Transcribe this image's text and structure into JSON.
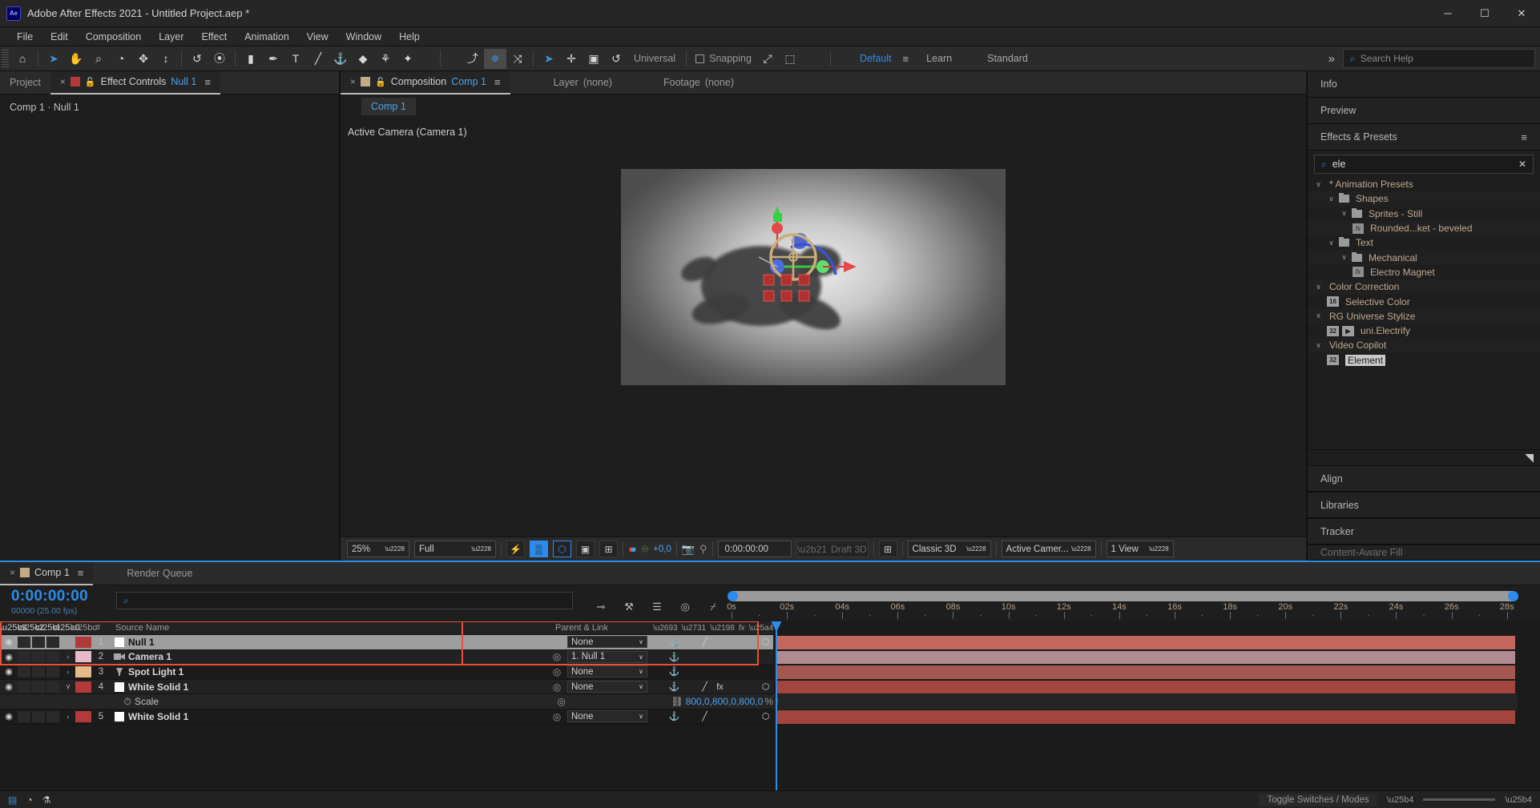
{
  "window": {
    "title": "Adobe After Effects 2021 - Untitled Project.aep *",
    "logo": "Ae",
    "minimize": "─",
    "maximize": "☐",
    "close": "✕"
  },
  "menubar": [
    "File",
    "Edit",
    "Composition",
    "Layer",
    "Effect",
    "Animation",
    "View",
    "Window",
    "Help"
  ],
  "toolbar": {
    "tools": [
      {
        "name": "home-icon",
        "glyph": "⌂"
      },
      {
        "name": "selection-tool",
        "glyph": "➤"
      },
      {
        "name": "hand-tool",
        "glyph": "✋"
      },
      {
        "name": "zoom-tool",
        "glyph": "⌕"
      },
      {
        "name": "orbit-tool",
        "glyph": "◔"
      },
      {
        "name": "pan-tool",
        "glyph": "✥"
      },
      {
        "name": "dolly-tool",
        "glyph": "↕"
      },
      {
        "name": "rotation-tool",
        "glyph": "↺"
      },
      {
        "name": "anchor-point-tool",
        "glyph": "⦿"
      },
      {
        "name": "rect-shape-tool",
        "glyph": "▮"
      },
      {
        "name": "pen-tool",
        "glyph": "✒"
      },
      {
        "name": "type-tool",
        "glyph": "T"
      },
      {
        "name": "brush-tool",
        "glyph": "╱"
      },
      {
        "name": "clone-stamp-tool",
        "glyph": "⚓"
      },
      {
        "name": "eraser-tool",
        "glyph": "◆"
      },
      {
        "name": "roto-brush-tool",
        "glyph": "⚘"
      },
      {
        "name": "puppet-pin-tool",
        "glyph": "✦"
      }
    ],
    "axis_tools": [
      {
        "name": "local-axis-mode",
        "glyph": "⤴"
      },
      {
        "name": "world-axis-mode",
        "glyph": "✵"
      },
      {
        "name": "view-axis-mode",
        "glyph": "⤨"
      }
    ],
    "gizmo_tools": [
      {
        "name": "gizmo-select",
        "glyph": "➤"
      },
      {
        "name": "gizmo-position",
        "glyph": "✛"
      },
      {
        "name": "gizmo-scale",
        "glyph": "▣"
      },
      {
        "name": "gizmo-rotate",
        "glyph": "↺"
      }
    ],
    "universal_label": "Universal",
    "snapping_label": "Snapping",
    "snap_tools": [
      {
        "name": "snap-align-icon",
        "glyph": "⤢"
      },
      {
        "name": "snap-grid-icon",
        "glyph": "⬚"
      }
    ],
    "workspaces": [
      "Default",
      "Learn",
      "Standard"
    ],
    "active_workspace": "Default",
    "workspace_menu_icon": "≡",
    "overflow_icon": "»",
    "search_help_placeholder": "Search Help",
    "search_icon": "⌕"
  },
  "left_panel": {
    "tabs": [
      {
        "label": "Project",
        "active": false,
        "name": "tab-project"
      },
      {
        "label": "Effect Controls",
        "sub": "Null 1",
        "active": true,
        "name": "tab-effect-controls",
        "swatch": "#b33a3a",
        "close": "×",
        "lock": "🔓",
        "menu": "≡"
      }
    ],
    "breadcrumb": "Comp 1 · Null 1"
  },
  "composition_panel": {
    "tabs": [
      {
        "label": "Composition",
        "sub": "Comp 1",
        "active": true,
        "name": "tab-composition",
        "swatch": "#c4ab83",
        "close": "×",
        "lock": "🔓",
        "menu": "≡"
      },
      {
        "label": "Layer",
        "sub": "(none)",
        "active": false,
        "name": "tab-layer"
      },
      {
        "label": "Footage",
        "sub": "(none)",
        "active": false,
        "name": "tab-footage"
      }
    ],
    "sub_tab": "Comp 1",
    "view_label": "Active Camera (Camera 1)",
    "viewer_bar": {
      "zoom": "25%",
      "resolution": "Full",
      "timecode": "0:00:00:00",
      "exposure": "+0,0",
      "draft3d": "Draft 3D",
      "renderer": "Classic 3D",
      "camera": "Active Camer...",
      "views": "1 View",
      "toggles": [
        {
          "name": "fast-preview-icon",
          "glyph": "⚡",
          "on": false
        },
        {
          "name": "transparency-grid-icon",
          "glyph": "▒",
          "on": true
        },
        {
          "name": "region-of-interest-icon",
          "glyph": "⬡",
          "on": true
        },
        {
          "name": "toggle-mask-paths-icon",
          "glyph": "▣",
          "on": false
        },
        {
          "name": "toggle-guides-icon",
          "glyph": "⊞",
          "on": false
        }
      ],
      "channel_icon": "●",
      "exposure_icon": "⌾",
      "snapshot_icon": "📷",
      "show_snapshot_icon": "⚲",
      "3d-ground-plane-icon": "⊞"
    }
  },
  "right_panel": {
    "sections_top": [
      {
        "label": "Info",
        "name": "panel-info"
      },
      {
        "label": "Preview",
        "name": "panel-preview"
      }
    ],
    "effects": {
      "title": "Effects & Presets",
      "menu_icon": "≡",
      "search_value": "ele",
      "search_icon": "⌕",
      "clear_icon": "✕",
      "tree": [
        {
          "label": "* Animation Presets",
          "indent": 0,
          "type": "group",
          "twirl": "∨"
        },
        {
          "label": "Shapes",
          "indent": 1,
          "type": "folder",
          "twirl": "∨"
        },
        {
          "label": "Sprites - Still",
          "indent": 2,
          "type": "folder",
          "twirl": "∨"
        },
        {
          "label": "Rounded...ket - beveled",
          "indent": 3,
          "type": "preset"
        },
        {
          "label": "Text",
          "indent": 1,
          "type": "folder",
          "twirl": "∨"
        },
        {
          "label": "Mechanical",
          "indent": 2,
          "type": "folder",
          "twirl": "∨"
        },
        {
          "label": "Electro Magnet",
          "indent": 3,
          "type": "preset"
        },
        {
          "label": "Color Correction",
          "indent": 0,
          "type": "group",
          "twirl": "∨"
        },
        {
          "label": "Selective Color",
          "indent": 1,
          "type": "effect",
          "bits": "16"
        },
        {
          "label": "RG Universe Stylize",
          "indent": 0,
          "type": "group",
          "twirl": "∨"
        },
        {
          "label": "uni.Electrify",
          "indent": 1,
          "type": "effect",
          "bits": "32",
          "extra": "▶"
        },
        {
          "label": "Video Copilot",
          "indent": 0,
          "type": "group",
          "twirl": "∨"
        },
        {
          "label": "Element",
          "indent": 1,
          "type": "effect",
          "bits": "32",
          "selected": true
        }
      ],
      "new_preset_icon": "◥"
    },
    "sections_bottom": [
      {
        "label": "Align",
        "name": "panel-align"
      },
      {
        "label": "Libraries",
        "name": "panel-libraries"
      },
      {
        "label": "Tracker",
        "name": "panel-tracker"
      },
      {
        "label": "Content-Aware Fill",
        "name": "panel-content-aware-fill"
      }
    ]
  },
  "timeline": {
    "tabs": [
      {
        "label": "Comp 1",
        "active": true,
        "name": "tab-timeline-comp1",
        "swatch": "#c4ab83",
        "close": "×",
        "menu": "≡"
      },
      {
        "label": "Render Queue",
        "active": false,
        "name": "tab-render-queue"
      }
    ],
    "current_time": "0:00:00:00",
    "frame_info": "00000 (25.00 fps)",
    "search_icon": "⌕",
    "search_placeholder": "",
    "toolbar_icons": [
      {
        "name": "composition-mini-flowchart-icon",
        "glyph": "⊸"
      },
      {
        "name": "draft-3d-icon",
        "glyph": "⚒"
      },
      {
        "name": "hide-shy-layers-icon",
        "glyph": "☰"
      },
      {
        "name": "frame-blending-icon",
        "glyph": "◎"
      },
      {
        "name": "graph-editor-icon",
        "glyph": "⌿"
      }
    ],
    "ruler": {
      "labels": [
        "0s",
        "02s",
        "04s",
        "06s",
        "08s",
        "10s",
        "12s",
        "14s",
        "16s",
        "18s",
        "20s",
        "22s",
        "24s",
        "26s",
        "28s"
      ],
      "dot": "."
    },
    "columns": {
      "source_name": "Source Name",
      "parent_link": "Parent & Link",
      "switch_icons": [
        "⚓",
        "✱",
        "↘",
        "fx",
        "▤",
        "◐",
        "◑",
        "⬡"
      ]
    },
    "layers": [
      {
        "num": "1",
        "name": "Null 1",
        "color": "#b33a3a",
        "icon": "solid",
        "parent": "None",
        "selected": true,
        "twirl": "›",
        "switches": [
          "⚓",
          "",
          "╱",
          "",
          "",
          "",
          "⬡"
        ],
        "bar_color": "#c4675e",
        "eye": "◉"
      },
      {
        "num": "2",
        "name": "Camera 1",
        "color": "#e8b9c8",
        "icon": "camera",
        "parent": "1. Null 1",
        "selected": false,
        "twirl": "›",
        "switches": [
          "⚓",
          "",
          "",
          "",
          "",
          "",
          ""
        ],
        "bar_color": "#b08b92",
        "eye": "◉"
      },
      {
        "num": "3",
        "name": "Spot Light 1",
        "color": "#e8b98a",
        "icon": "light",
        "parent": "None",
        "selected": false,
        "twirl": "›",
        "switches": [
          "⚓",
          "",
          "",
          "",
          "",
          "",
          ""
        ],
        "bar_color": "#a3574f",
        "eye": "◉"
      },
      {
        "num": "4",
        "name": "White Solid 1",
        "color": "#b33a3a",
        "icon": "solid",
        "parent": "None",
        "selected": false,
        "twirl": "∨",
        "switches": [
          "⚓",
          "",
          "╱",
          "fx",
          "",
          "",
          "⬡"
        ],
        "bar_color": "#a3453f",
        "eye": "◉",
        "expanded": true
      },
      {
        "num": "5",
        "name": "White Solid 1",
        "color": "#b33a3a",
        "icon": "solid",
        "parent": "None",
        "selected": false,
        "twirl": "›",
        "switches": [
          "⚓",
          "",
          "╱",
          "",
          "",
          "",
          "⬡"
        ],
        "bar_color": "#a3453f",
        "eye": "◉"
      }
    ],
    "property_row": {
      "stopwatch": "⏱",
      "name": "Scale",
      "link_icon": "⛓",
      "value": "800,0,800,0,800,0",
      "unit": "%"
    },
    "footer": {
      "toggle_switches_modes": "Toggle Switches / Modes",
      "icons": [
        {
          "name": "new-comp-icon",
          "glyph": "▤"
        },
        {
          "name": "delete-icon",
          "glyph": "◔"
        },
        {
          "name": "motion-blur-icon",
          "glyph": "⚗"
        }
      ]
    }
  },
  "colors": {
    "accent_blue": "#2d8ceb",
    "highlight_red": "#e8503a",
    "label_tan": "#b9a189",
    "selected_row": "#9e9e9e"
  }
}
